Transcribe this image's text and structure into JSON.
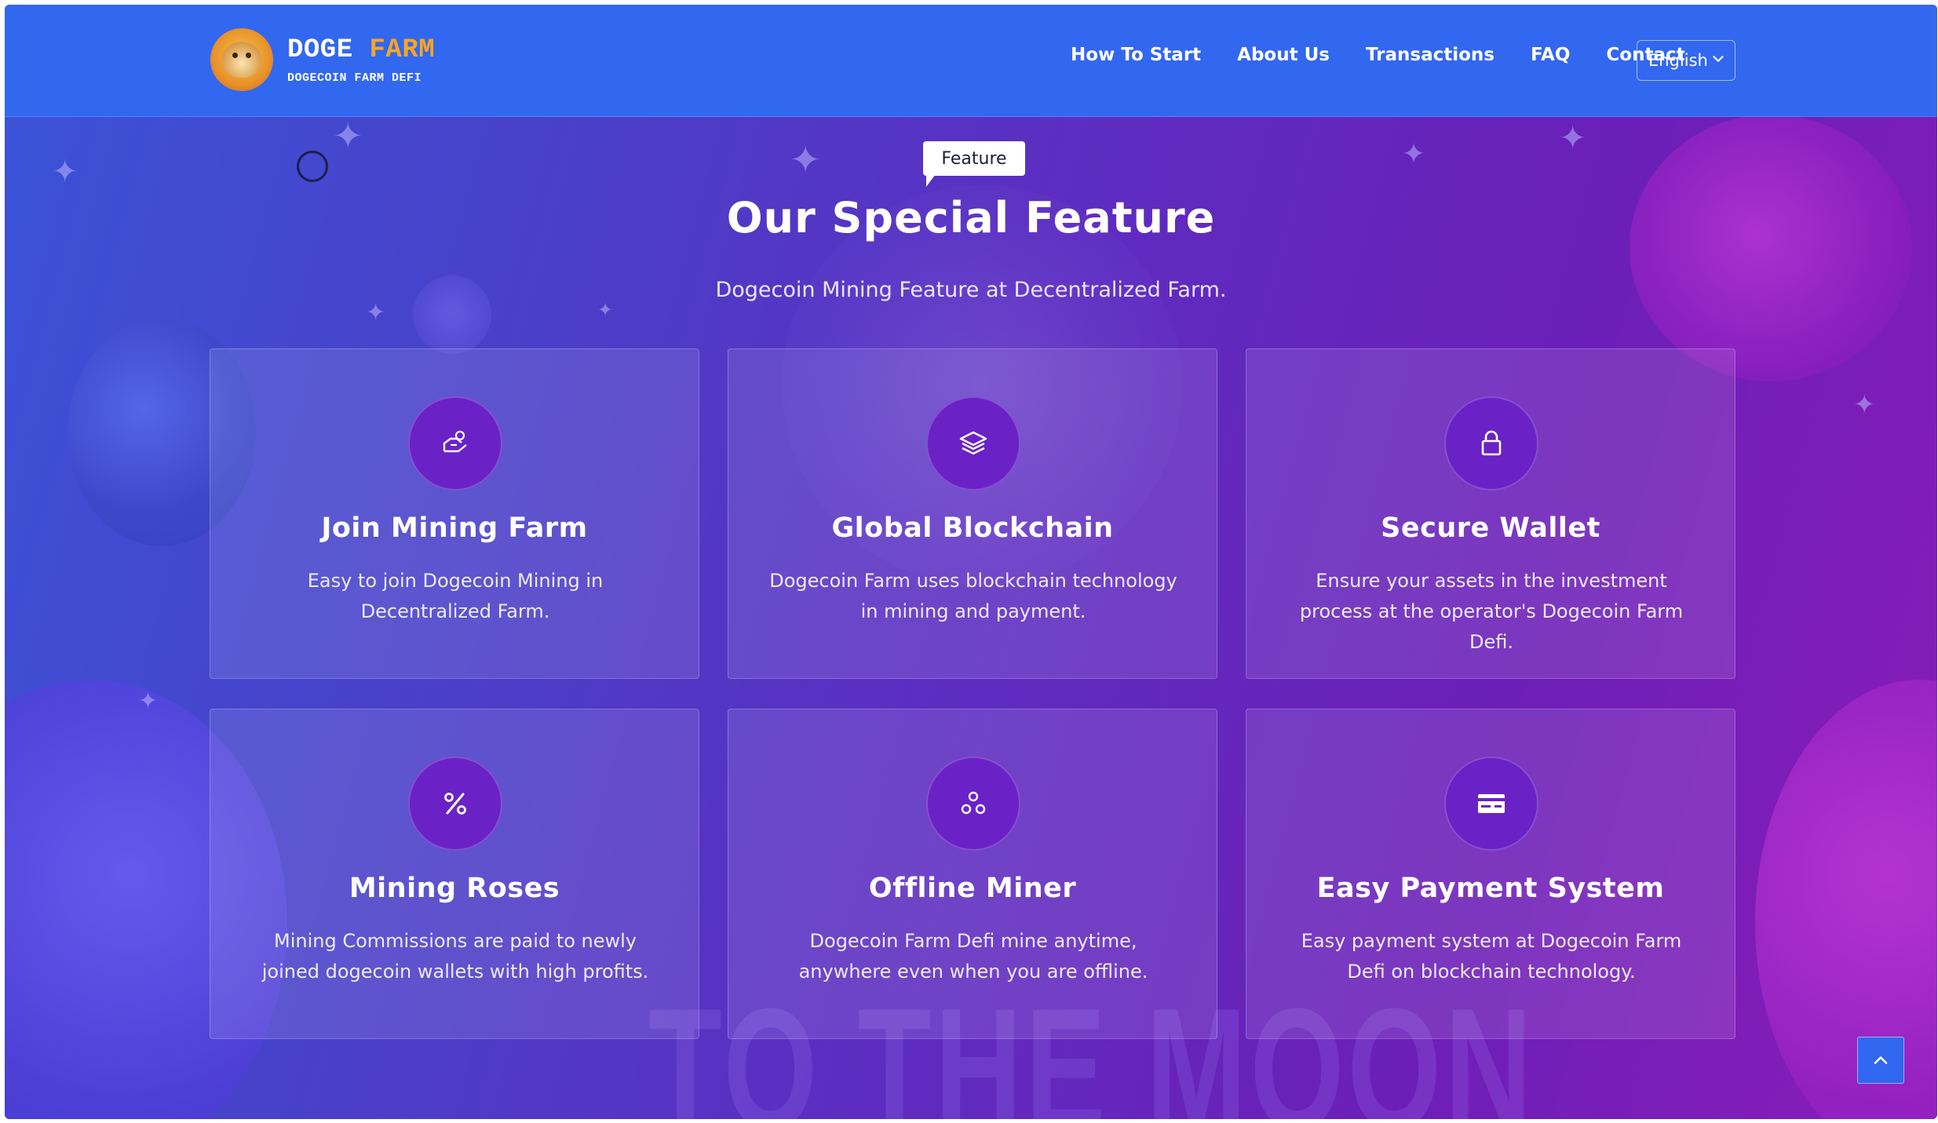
{
  "brand": {
    "name_part1": "DOGE",
    "name_part2": "FARM",
    "tagline": "DOGECOIN FARM DEFI",
    "accent_color": "#f5a623"
  },
  "nav": {
    "items": [
      {
        "label": "How To Start"
      },
      {
        "label": "About Us"
      },
      {
        "label": "Transactions"
      },
      {
        "label": "FAQ"
      },
      {
        "label": "Contact"
      }
    ],
    "language": "English"
  },
  "section": {
    "tag": "Feature",
    "title": "Our Special Feature",
    "subtitle": "Dogecoin Mining Feature at Decentralized Farm."
  },
  "features": [
    {
      "icon": "hand-coin-icon",
      "title": "Join Mining Farm",
      "description": "Easy to join Dogecoin Mining in Decentralized Farm."
    },
    {
      "icon": "layers-icon",
      "title": "Global Blockchain",
      "description": "Dogecoin Farm uses blockchain technology in mining and payment."
    },
    {
      "icon": "lock-icon",
      "title": "Secure Wallet",
      "description": "Ensure your assets in the investment process at the operator's Dogecoin Farm Defi."
    },
    {
      "icon": "percent-icon",
      "title": "Mining Roses",
      "description": "Mining Commissions are paid to newly joined dogecoin wallets with high profits."
    },
    {
      "icon": "network-icon",
      "title": "Offline Miner",
      "description": "Dogecoin Farm Defi mine anytime, anywhere even when you are offline."
    },
    {
      "icon": "credit-card-icon",
      "title": "Easy Payment System",
      "description": "Easy payment system at Dogecoin Farm Defi on blockchain technology."
    }
  ],
  "background_text": "TO THE MOON",
  "colors": {
    "header": "#3267f0",
    "icon_circle": "#6a22c6"
  }
}
